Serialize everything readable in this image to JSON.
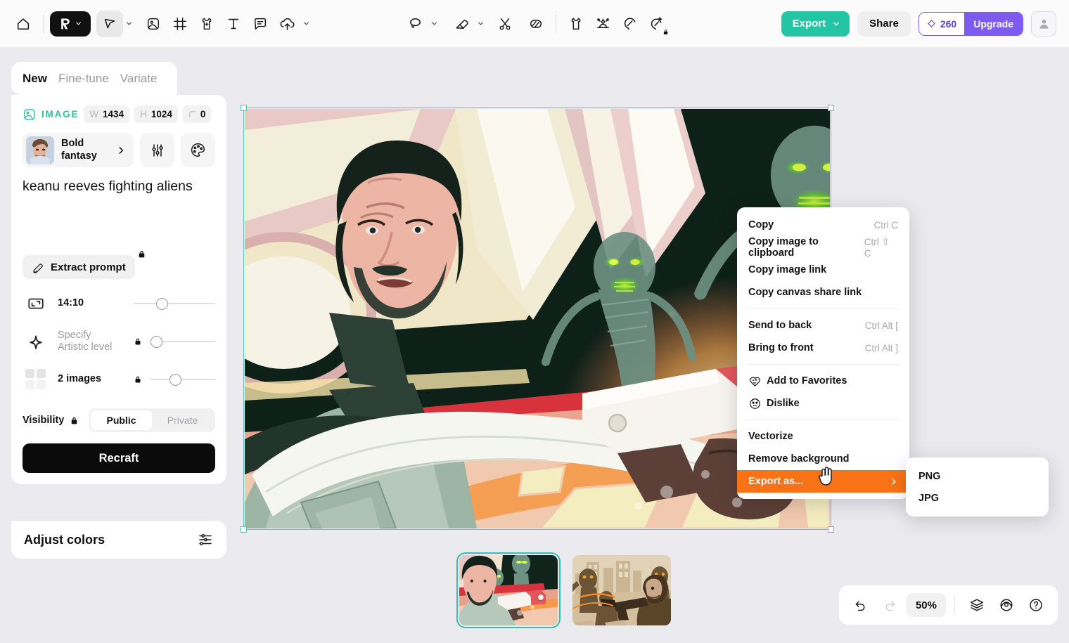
{
  "toolbar": {
    "home_icon": "home-icon",
    "logo_icon": "recraft-logo-icon",
    "tools": [
      {
        "name": "select-tool",
        "icon": "cursor-icon",
        "active": true
      },
      {
        "name": "image-tool",
        "icon": "image-icon",
        "active": false
      },
      {
        "name": "frame-tool",
        "icon": "frame-icon",
        "active": false
      },
      {
        "name": "mockup-tool",
        "icon": "tshirt-plus-icon",
        "active": false
      },
      {
        "name": "text-tool",
        "icon": "text-icon",
        "active": false
      },
      {
        "name": "comment-tool",
        "icon": "comment-icon",
        "active": false
      },
      {
        "name": "upload-tool",
        "icon": "upload-cloud-icon",
        "active": false
      }
    ],
    "edit_tools": [
      {
        "name": "lasso-tool",
        "icon": "lasso-icon"
      },
      {
        "name": "eraser-tool",
        "icon": "eraser-icon"
      },
      {
        "name": "cut-tool",
        "icon": "scissors-icon"
      },
      {
        "name": "inpaint-tool",
        "icon": "patch-icon"
      }
    ],
    "gen_tools": [
      {
        "name": "apparel-tool",
        "icon": "tshirt-icon"
      },
      {
        "name": "mockup-scene-tool",
        "icon": "mockup-icon"
      },
      {
        "name": "magic-tool",
        "icon": "magic-wand-icon"
      },
      {
        "name": "enhance-tool",
        "icon": "sparkle-wand-icon"
      }
    ],
    "export_label": "Export",
    "share_label": "Share",
    "credits_value": "260",
    "upgrade_label": "Upgrade",
    "avatar_icon": "user-avatar-icon"
  },
  "panel": {
    "tabs": [
      {
        "label": "New",
        "active": true
      },
      {
        "label": "Fine-tune",
        "active": false
      },
      {
        "label": "Variate",
        "active": false
      }
    ],
    "meta": {
      "type_label": "IMAGE",
      "width_key": "W",
      "width_value": "1434",
      "height_key": "H",
      "height_value": "1024",
      "corner_key": "corner-radius-icon",
      "corner_value": "0"
    },
    "style": {
      "name": "Bold fantasy",
      "name_line1": "Bold",
      "name_line2": "fantasy",
      "chevron": "chevron-right-icon",
      "settings_icon": "sliders-icon",
      "palette_icon": "palette-icon"
    },
    "prompt_text": "keanu reeves fighting aliens",
    "extract_prompt_label": "Extract prompt",
    "extract_prompt_icon": "highlighter-icon",
    "controls": [
      {
        "name": "aspect-ratio",
        "icon": "aspect-ratio-icon",
        "label": "14:10",
        "muted": false,
        "locked": false,
        "slider_pct": 34
      },
      {
        "name": "artistic-level",
        "icon": "star-four-icon",
        "label_line1": "Specify",
        "label_line2": "Artistic level",
        "label": "Specify Artistic level",
        "muted": true,
        "locked": true,
        "slider_pct": 0
      },
      {
        "name": "image-count",
        "icon": "grid-four-icon",
        "label": "2 images",
        "muted": false,
        "locked": true,
        "slider_pct": 30
      }
    ],
    "visibility": {
      "label": "Visibility",
      "lock_icon": "lock-icon",
      "options": [
        {
          "label": "Public",
          "selected": true
        },
        {
          "label": "Private",
          "selected": false
        }
      ]
    },
    "recraft_label": "Recraft",
    "adjust_colors_label": "Adjust colors",
    "adjust_colors_icon": "color-sliders-icon"
  },
  "context_menu": {
    "items": [
      {
        "label": "Copy",
        "shortcut": "Ctrl C",
        "icon": null,
        "highlighted": false,
        "submenu": false
      },
      {
        "label": "Copy image to clipboard",
        "shortcut": "Ctrl ⇧ C",
        "icon": null,
        "highlighted": false,
        "submenu": false
      },
      {
        "label": "Copy image link",
        "shortcut": "",
        "icon": null,
        "highlighted": false,
        "submenu": false
      },
      {
        "label": "Copy canvas share link",
        "shortcut": "",
        "icon": null,
        "highlighted": false,
        "submenu": false
      },
      {
        "divider": true
      },
      {
        "label": "Send to back",
        "shortcut": "Ctrl Alt [",
        "icon": null,
        "highlighted": false,
        "submenu": false
      },
      {
        "label": "Bring to front",
        "shortcut": "Ctrl Alt ]",
        "icon": null,
        "highlighted": false,
        "submenu": false
      },
      {
        "divider": true
      },
      {
        "label": "Add to Favorites",
        "shortcut": "",
        "icon": "heart-wink-icon",
        "highlighted": false,
        "submenu": false
      },
      {
        "label": "Dislike",
        "shortcut": "",
        "icon": "sad-face-icon",
        "highlighted": false,
        "submenu": false
      },
      {
        "divider": true
      },
      {
        "label": "Vectorize",
        "shortcut": "",
        "icon": null,
        "highlighted": false,
        "submenu": false
      },
      {
        "label": "Remove background",
        "shortcut": "",
        "icon": null,
        "highlighted": false,
        "submenu": false
      },
      {
        "label": "Export as...",
        "shortcut": "",
        "icon": null,
        "highlighted": true,
        "submenu": true
      }
    ],
    "submenu_items": [
      {
        "label": "PNG"
      },
      {
        "label": "JPG"
      }
    ],
    "highlight_color": "#f97316"
  },
  "bottom_toolbar": {
    "undo_icon": "undo-icon",
    "redo_icon": "redo-icon",
    "zoom_value": "50%",
    "layers_icon": "layers-icon",
    "preview_icon": "eye-icon",
    "help_icon": "question-circle-icon"
  },
  "thumbnails": [
    {
      "name": "thumbnail-1",
      "selected": true
    },
    {
      "name": "thumbnail-2",
      "selected": false
    }
  ],
  "colors": {
    "export_green": "#24c5a4",
    "upgrade_purple": "#7d5bf0",
    "selection_teal": "#4fc8bd",
    "menu_highlight": "#f97316",
    "accent_mint": "#2fbfa0"
  }
}
